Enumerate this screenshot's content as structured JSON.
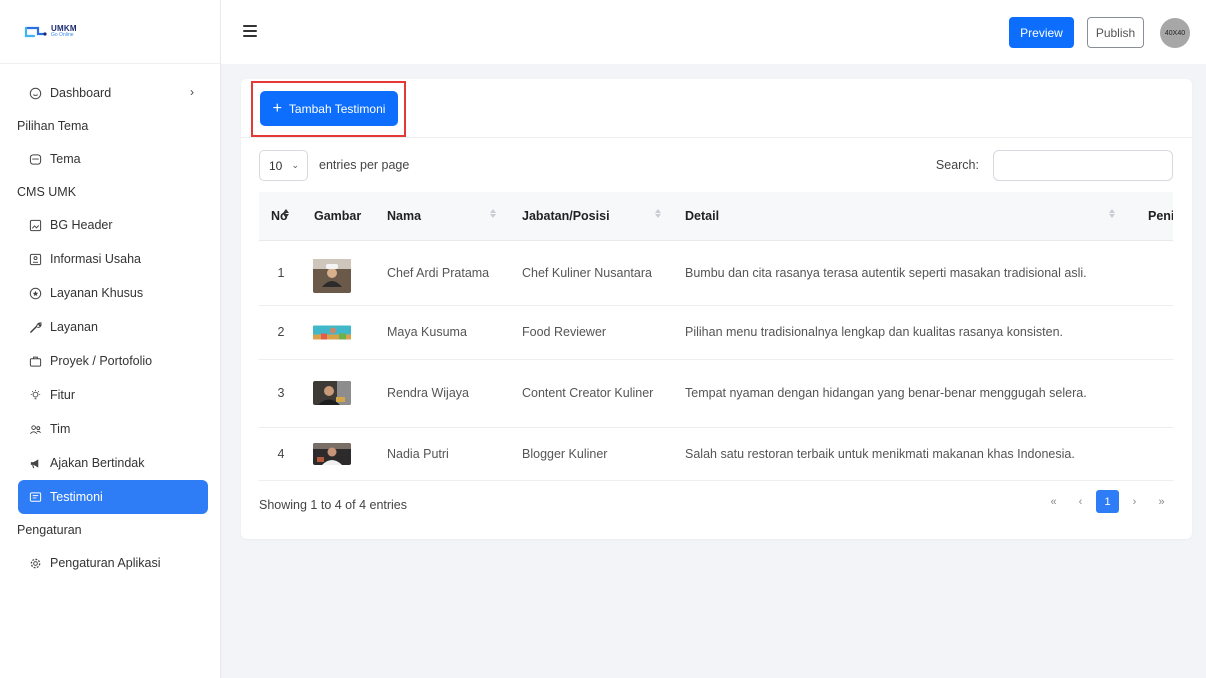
{
  "app": {
    "logo_text": "UMKM",
    "logo_sub": "Go Online"
  },
  "topbar": {
    "preview_label": "Preview",
    "publish_label": "Publish",
    "avatar_text": "40X40"
  },
  "sidebar": {
    "dashboard": "Dashboard",
    "section_pilihan_tema": "Pilihan Tema",
    "tema": "Tema",
    "section_cms": "CMS UMK",
    "bg_header": "BG Header",
    "informasi_usaha": "Informasi Usaha",
    "layanan_khusus": "Layanan Khusus",
    "layanan": "Layanan",
    "proyek": "Proyek / Portofolio",
    "fitur": "Fitur",
    "tim": "Tim",
    "ajakan": "Ajakan Bertindak",
    "testimoni": "Testimoni",
    "section_pengaturan": "Pengaturan",
    "pengaturan_aplikasi": "Pengaturan Aplikasi"
  },
  "main": {
    "add_button": "Tambah Testimoni",
    "entries_value": "10",
    "entries_label": "entries per page",
    "search_label": "Search:",
    "search_value": "",
    "columns": {
      "no": "No",
      "gambar": "Gambar",
      "nama": "Nama",
      "jabatan": "Jabatan/Posisi",
      "detail": "Detail",
      "penilaian": "Penila"
    },
    "rows": [
      {
        "no": "1",
        "nama": "Chef Ardi Pratama",
        "jabatan": "Chef Kuliner Nusantara",
        "detail": "Bumbu dan cita rasanya terasa autentik seperti masakan tradisional asli."
      },
      {
        "no": "2",
        "nama": "Maya Kusuma",
        "jabatan": "Food Reviewer",
        "detail": "Pilihan menu tradisionalnya lengkap dan kualitas rasanya konsisten."
      },
      {
        "no": "3",
        "nama": "Rendra Wijaya",
        "jabatan": "Content Creator Kuliner",
        "detail": "Tempat nyaman dengan hidangan yang benar-benar menggugah selera."
      },
      {
        "no": "4",
        "nama": "Nadia Putri",
        "jabatan": "Blogger Kuliner",
        "detail": "Salah satu restoran terbaik untuk menikmati makanan khas Indonesia."
      }
    ],
    "info": "Showing 1 to 4 of 4 entries",
    "pager": {
      "first": "«",
      "prev": "‹",
      "current": "1",
      "next": "›",
      "last": "»"
    }
  },
  "colors": {
    "primary": "#0d6efd",
    "sidebar_active": "#2f7df6",
    "highlight_border": "#e53935"
  }
}
